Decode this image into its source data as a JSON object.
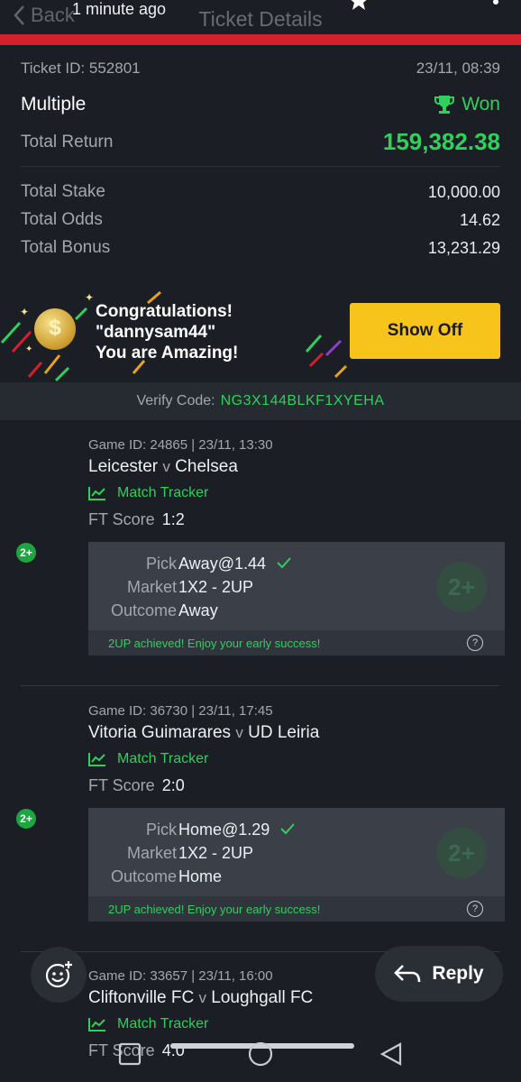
{
  "header": {
    "back_label": "Back",
    "title": "Ticket Details",
    "notification": "1 minute ago"
  },
  "ticket": {
    "id_label": "Ticket ID: 552801",
    "datetime": "23/11, 08:39",
    "bet_type": "Multiple",
    "status": "Won",
    "total_return_label": "Total Return",
    "total_return": "159,382.38",
    "total_stake_label": "Total Stake",
    "total_stake": "10,000.00",
    "total_odds_label": "Total Odds",
    "total_odds": "14.62",
    "total_bonus_label": "Total Bonus",
    "total_bonus": "13,231.29"
  },
  "congrats": {
    "line1": "Congratulations!",
    "line2": "\"dannysam44\"",
    "line3": "You are Amazing!",
    "coin_symbol": "$",
    "button": "Show Off"
  },
  "verify": {
    "label": "Verify Code:",
    "code": "NG3X144BLKF1XYEHA"
  },
  "games": [
    {
      "id_line": "Game ID: 24865 | 23/11, 13:30",
      "home": "Leicester",
      "away": "Chelsea",
      "vs": "v",
      "tracker": "Match Tracker",
      "score_label": "FT Score",
      "score": "1:2",
      "badge": "2+",
      "pick_label": "Pick",
      "pick": "Away@1.44",
      "market_label": "Market",
      "market": "1X2 - 2UP",
      "outcome_label": "Outcome",
      "outcome": "Away",
      "footer": "2UP achieved! Enjoy your early success!",
      "watermark": "2+"
    },
    {
      "id_line": "Game ID: 36730 | 23/11, 17:45",
      "home": "Vitoria Guimarares",
      "away": "UD Leiria",
      "vs": "v",
      "tracker": "Match Tracker",
      "score_label": "FT Score",
      "score": "2:0",
      "badge": "2+",
      "pick_label": "Pick",
      "pick": "Home@1.29",
      "market_label": "Market",
      "market": "1X2 - 2UP",
      "outcome_label": "Outcome",
      "outcome": "Home",
      "footer": "2UP achieved! Enjoy your early success!",
      "watermark": "2+"
    },
    {
      "id_line": "Game ID: 33657 | 23/11, 16:00",
      "home": "Cliftonville FC",
      "away": "Loughgall FC",
      "vs": "v",
      "tracker": "Match Tracker",
      "score_label": "FT Score",
      "score": "4:0"
    }
  ],
  "overlay": {
    "reply_label": "Reply"
  },
  "colors": {
    "accent_red": "#d4202c",
    "win_green": "#2fd05b",
    "button_yellow": "#f7c41b",
    "background": "#1b1e24"
  }
}
